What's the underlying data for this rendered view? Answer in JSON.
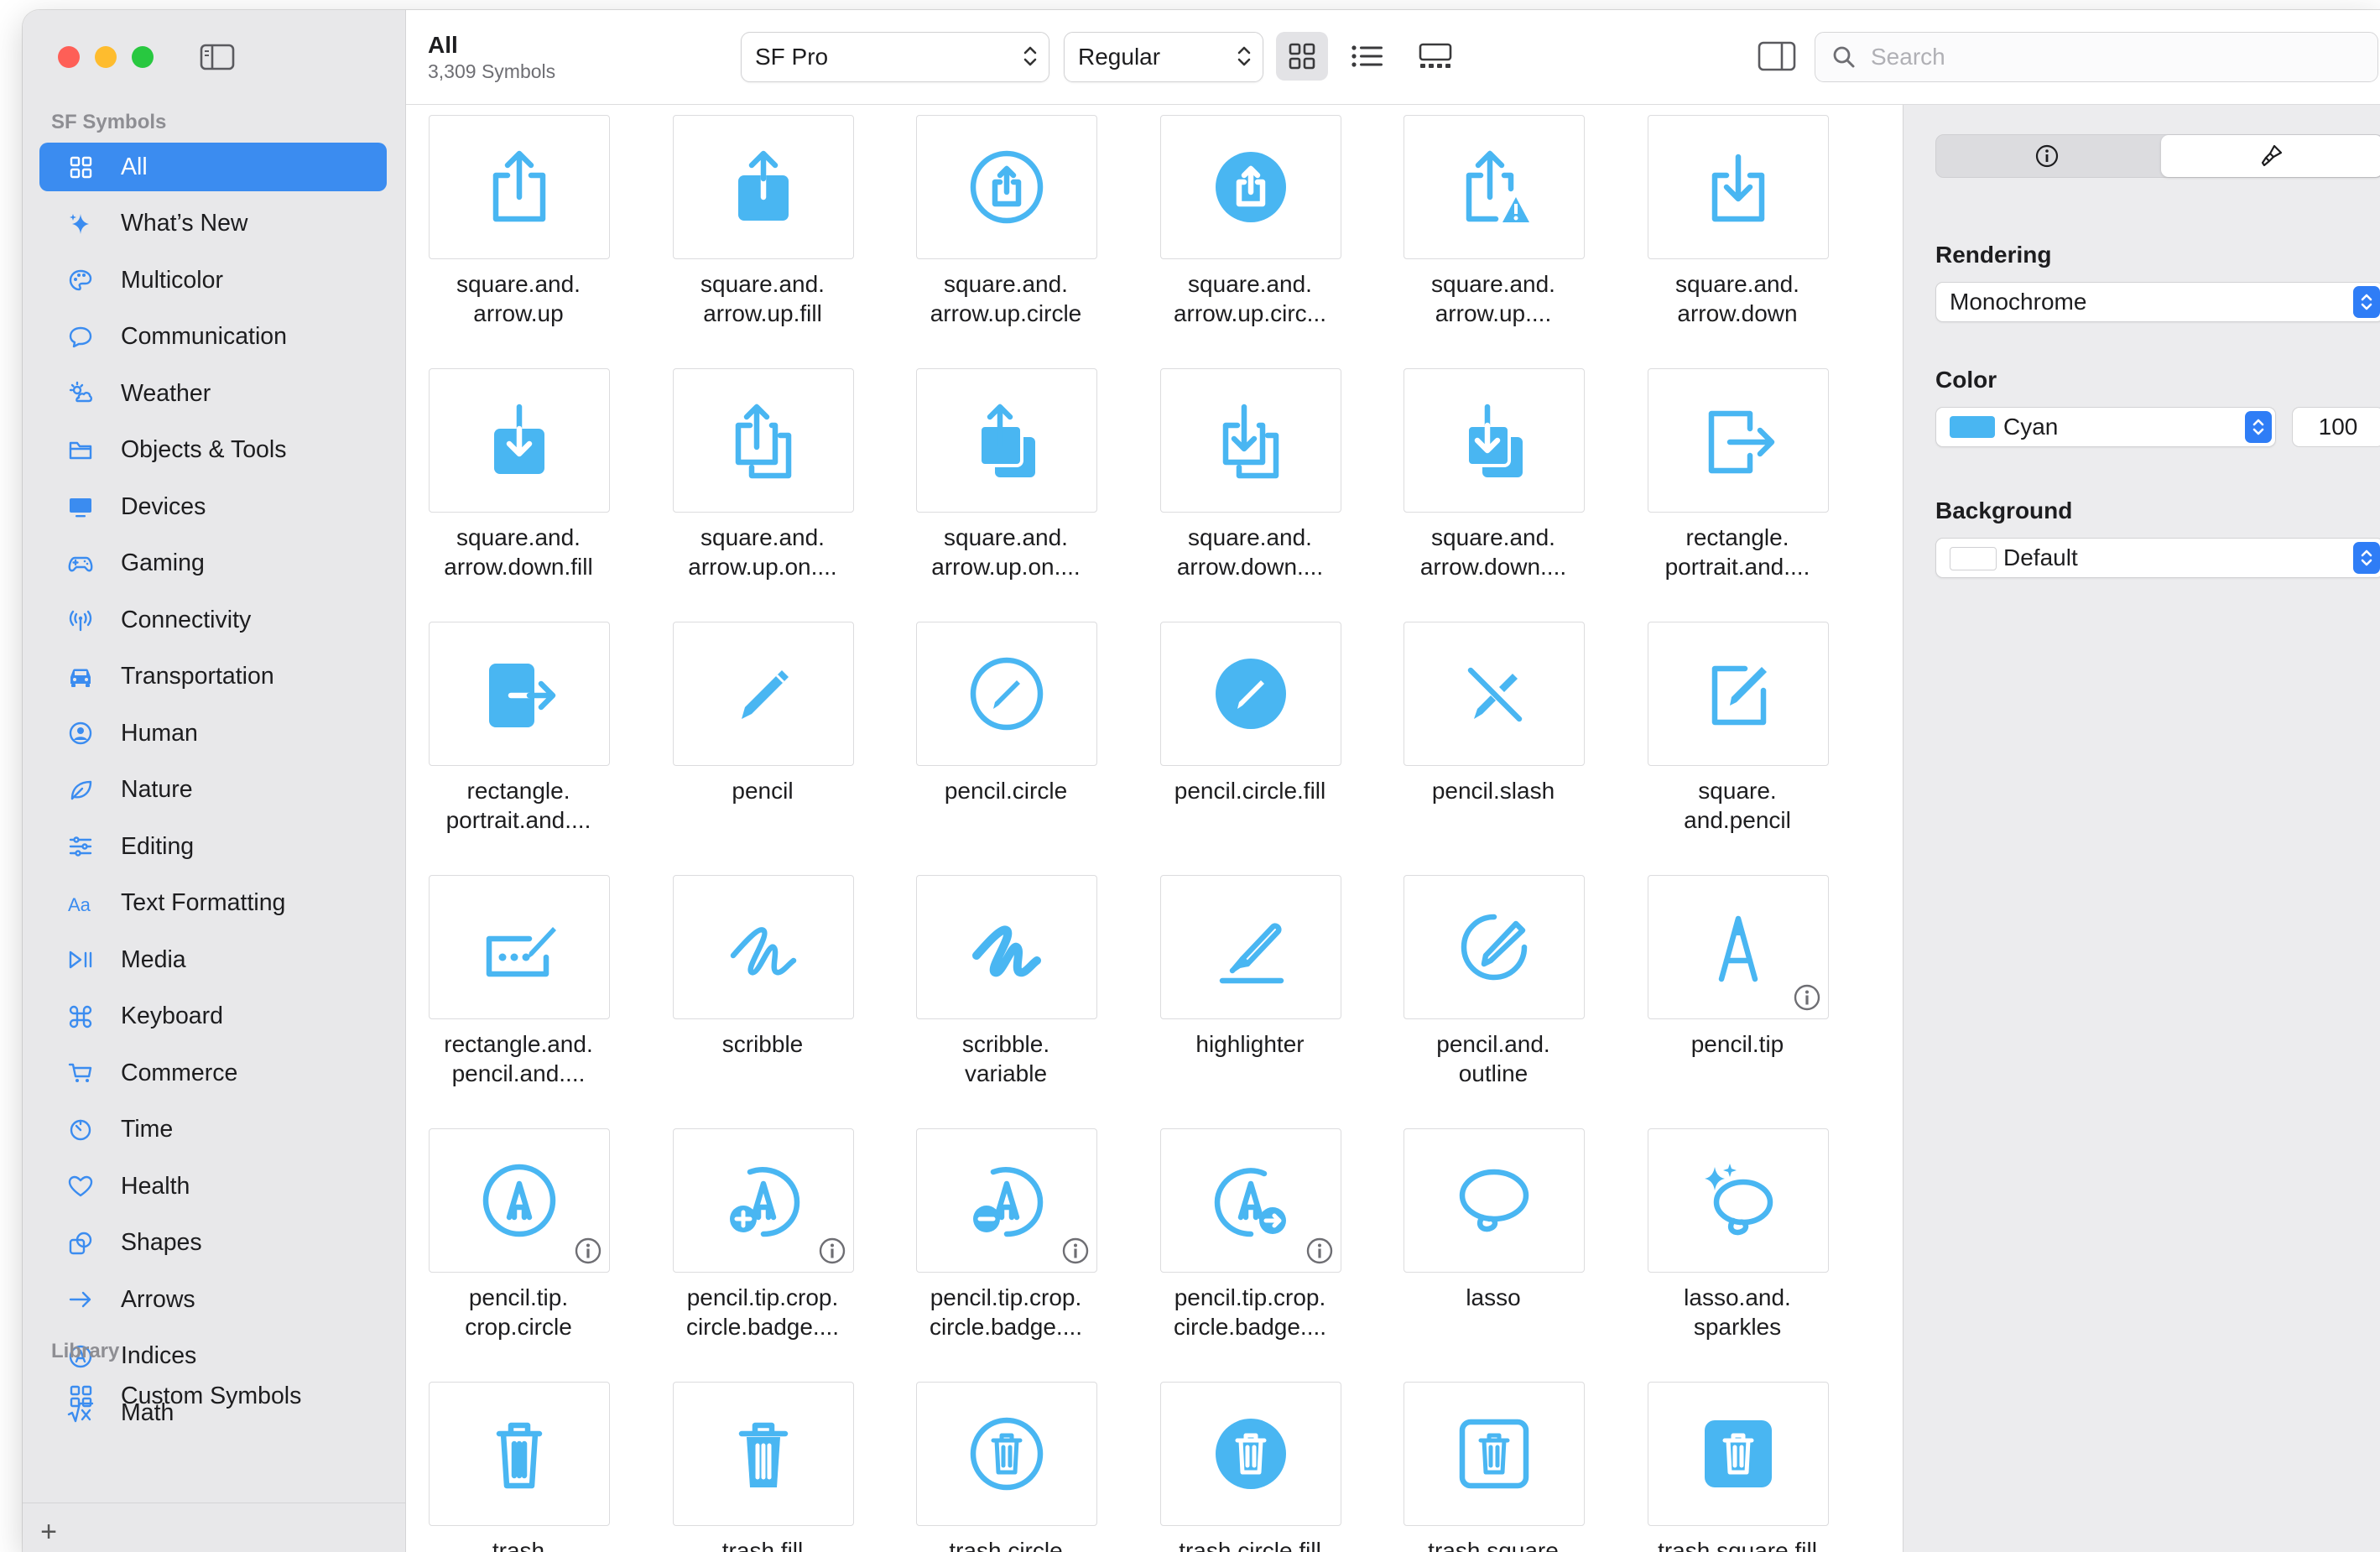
{
  "window": {
    "title": "SF Symbols"
  },
  "sidebar": {
    "section_sf": "SF Symbols",
    "section_library": "Library",
    "items": [
      {
        "label": "All",
        "icon": "grid-icon",
        "active": true
      },
      {
        "label": "What’s New",
        "icon": "sparkle-icon"
      },
      {
        "label": "Multicolor",
        "icon": "palette-icon"
      },
      {
        "label": "Communication",
        "icon": "message-bubble-icon"
      },
      {
        "label": "Weather",
        "icon": "sun-cloud-icon"
      },
      {
        "label": "Objects & Tools",
        "icon": "folder-icon"
      },
      {
        "label": "Devices",
        "icon": "display-icon"
      },
      {
        "label": "Gaming",
        "icon": "gamecontroller-icon"
      },
      {
        "label": "Connectivity",
        "icon": "antenna-icon"
      },
      {
        "label": "Transportation",
        "icon": "car-icon"
      },
      {
        "label": "Human",
        "icon": "person-circle-icon"
      },
      {
        "label": "Nature",
        "icon": "leaf-icon"
      },
      {
        "label": "Editing",
        "icon": "sliders-icon"
      },
      {
        "label": "Text Formatting",
        "icon": "text-aa-icon"
      },
      {
        "label": "Media",
        "icon": "play-pause-icon"
      },
      {
        "label": "Keyboard",
        "icon": "command-icon"
      },
      {
        "label": "Commerce",
        "icon": "cart-icon"
      },
      {
        "label": "Time",
        "icon": "timer-icon"
      },
      {
        "label": "Health",
        "icon": "heart-icon"
      },
      {
        "label": "Shapes",
        "icon": "shapes-icon"
      },
      {
        "label": "Arrows",
        "icon": "arrow-right-icon"
      },
      {
        "label": "Indices",
        "icon": "a-circle-icon"
      },
      {
        "label": "Math",
        "icon": "sqrt-x-icon"
      }
    ],
    "library_items": [
      {
        "label": "Custom Symbols",
        "icon": "grid-icon"
      }
    ],
    "add_label": "+"
  },
  "toolbar": {
    "title": "All",
    "subtitle": "3,309 Symbols",
    "font_value": "SF Pro",
    "weight_value": "Regular",
    "search_placeholder": "Search",
    "search_value": ""
  },
  "symbols": [
    {
      "l1": "square.and.",
      "l2": "arrow.up",
      "glyph": "share"
    },
    {
      "l1": "square.and.",
      "l2": "arrow.up.fill",
      "glyph": "share-fill"
    },
    {
      "l1": "square.and.",
      "l2": "arrow.up.circle",
      "glyph": "share-circle"
    },
    {
      "l1": "square.and.",
      "l2": "arrow.up.circ...",
      "glyph": "share-circle-fill"
    },
    {
      "l1": "square.and.",
      "l2": "arrow.up....",
      "glyph": "share-warning"
    },
    {
      "l1": "square.and.",
      "l2": "arrow.down",
      "glyph": "down"
    },
    {
      "l1": "square.and.",
      "l2": "arrow.down.fill",
      "glyph": "down-fill"
    },
    {
      "l1": "square.and.",
      "l2": "arrow.up.on....",
      "glyph": "share-stack"
    },
    {
      "l1": "square.and.",
      "l2": "arrow.up.on....",
      "glyph": "share-stack-fill"
    },
    {
      "l1": "square.and.",
      "l2": "arrow.down....",
      "glyph": "down-stack"
    },
    {
      "l1": "square.and.",
      "l2": "arrow.down....",
      "glyph": "down-stack-fill"
    },
    {
      "l1": "rectangle.",
      "l2": "portrait.and....",
      "glyph": "portrait-arrow"
    },
    {
      "l1": "rectangle.",
      "l2": "portrait.and....",
      "glyph": "portrait-arrow-fill"
    },
    {
      "l1": "pencil",
      "l2": "",
      "glyph": "pencil"
    },
    {
      "l1": "pencil.circle",
      "l2": "",
      "glyph": "pencil-circle"
    },
    {
      "l1": "pencil.circle.fill",
      "l2": "",
      "glyph": "pencil-circle-fill"
    },
    {
      "l1": "pencil.slash",
      "l2": "",
      "glyph": "pencil-slash"
    },
    {
      "l1": "square.",
      "l2": "and.pencil",
      "glyph": "square-pencil"
    },
    {
      "l1": "rectangle.and.",
      "l2": "pencil.and....",
      "glyph": "rect-pencil"
    },
    {
      "l1": "scribble",
      "l2": "",
      "glyph": "scribble"
    },
    {
      "l1": "scribble.",
      "l2": "variable",
      "glyph": "scribble-variable"
    },
    {
      "l1": "highlighter",
      "l2": "",
      "glyph": "highlighter"
    },
    {
      "l1": "pencil.and.",
      "l2": "outline",
      "glyph": "pencil-outline"
    },
    {
      "l1": "pencil.tip",
      "l2": "",
      "glyph": "pencil-tip",
      "info": true
    },
    {
      "l1": "pencil.tip.",
      "l2": "crop.circle",
      "glyph": "tip-circle",
      "info": true
    },
    {
      "l1": "pencil.tip.crop.",
      "l2": "circle.badge....",
      "glyph": "tip-plus",
      "info": true
    },
    {
      "l1": "pencil.tip.crop.",
      "l2": "circle.badge....",
      "glyph": "tip-minus",
      "info": true
    },
    {
      "l1": "pencil.tip.crop.",
      "l2": "circle.badge....",
      "glyph": "tip-arrow",
      "info": true
    },
    {
      "l1": "lasso",
      "l2": "",
      "glyph": "lasso"
    },
    {
      "l1": "lasso.and.",
      "l2": "sparkles",
      "glyph": "lasso-sparkles"
    },
    {
      "l1": "trash",
      "l2": "",
      "glyph": "trash"
    },
    {
      "l1": "trash.fill",
      "l2": "",
      "glyph": "trash-fill"
    },
    {
      "l1": "trash.circle",
      "l2": "",
      "glyph": "trash-circle"
    },
    {
      "l1": "trash.circle.fill",
      "l2": "",
      "glyph": "trash-circle-fill"
    },
    {
      "l1": "trash.square",
      "l2": "",
      "glyph": "trash-square"
    },
    {
      "l1": "trash.square.fill",
      "l2": "",
      "glyph": "trash-square-fill"
    }
  ],
  "inspector": {
    "tab_info_icon": "info-circle-icon",
    "tab_customize_icon": "paintbrush-icon",
    "rendering_label": "Rendering",
    "rendering_value": "Monochrome",
    "color_label": "Color",
    "color_value": "Cyan",
    "color_swatch": "#49b6f2",
    "opacity_value": "100",
    "background_label": "Background",
    "background_value": "Default"
  },
  "colors": {
    "accent": "#3b8cf0",
    "symbol": "#49b6f2"
  }
}
